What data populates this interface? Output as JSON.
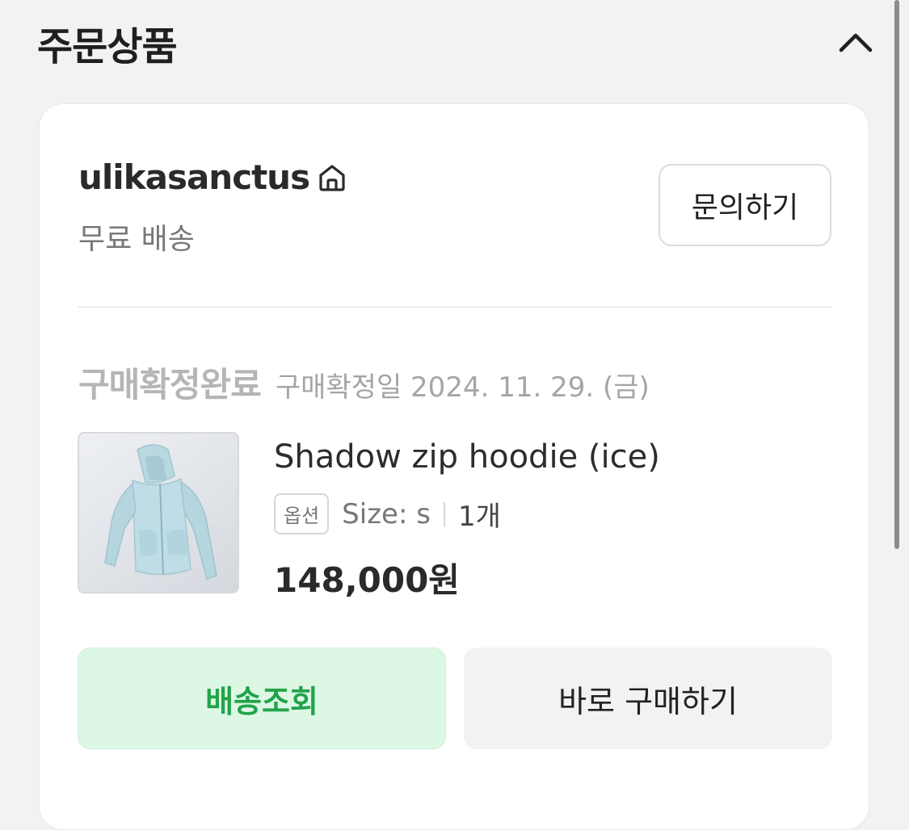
{
  "section": {
    "title": "주문상품",
    "collapse_icon": "chevron-up-icon"
  },
  "seller": {
    "name": "ulikasanctus",
    "home_icon": "home-icon",
    "shipping": "무료 배송",
    "inquiry_label": "문의하기"
  },
  "order": {
    "status": "구매확정완료",
    "confirm_date": "구매확정일 2024. 11. 29. (금)",
    "item": {
      "name": "Shadow zip hoodie (ice)",
      "option_badge": "옵션",
      "option_value": "Size: s",
      "quantity": "1개",
      "price": "148,000원"
    }
  },
  "actions": {
    "track_label": "배송조회",
    "buy_again_label": "바로 구매하기"
  },
  "colors": {
    "track_bg": "#ddf7e5",
    "track_text": "#22a34a",
    "page_bg": "#f1f2f4"
  }
}
